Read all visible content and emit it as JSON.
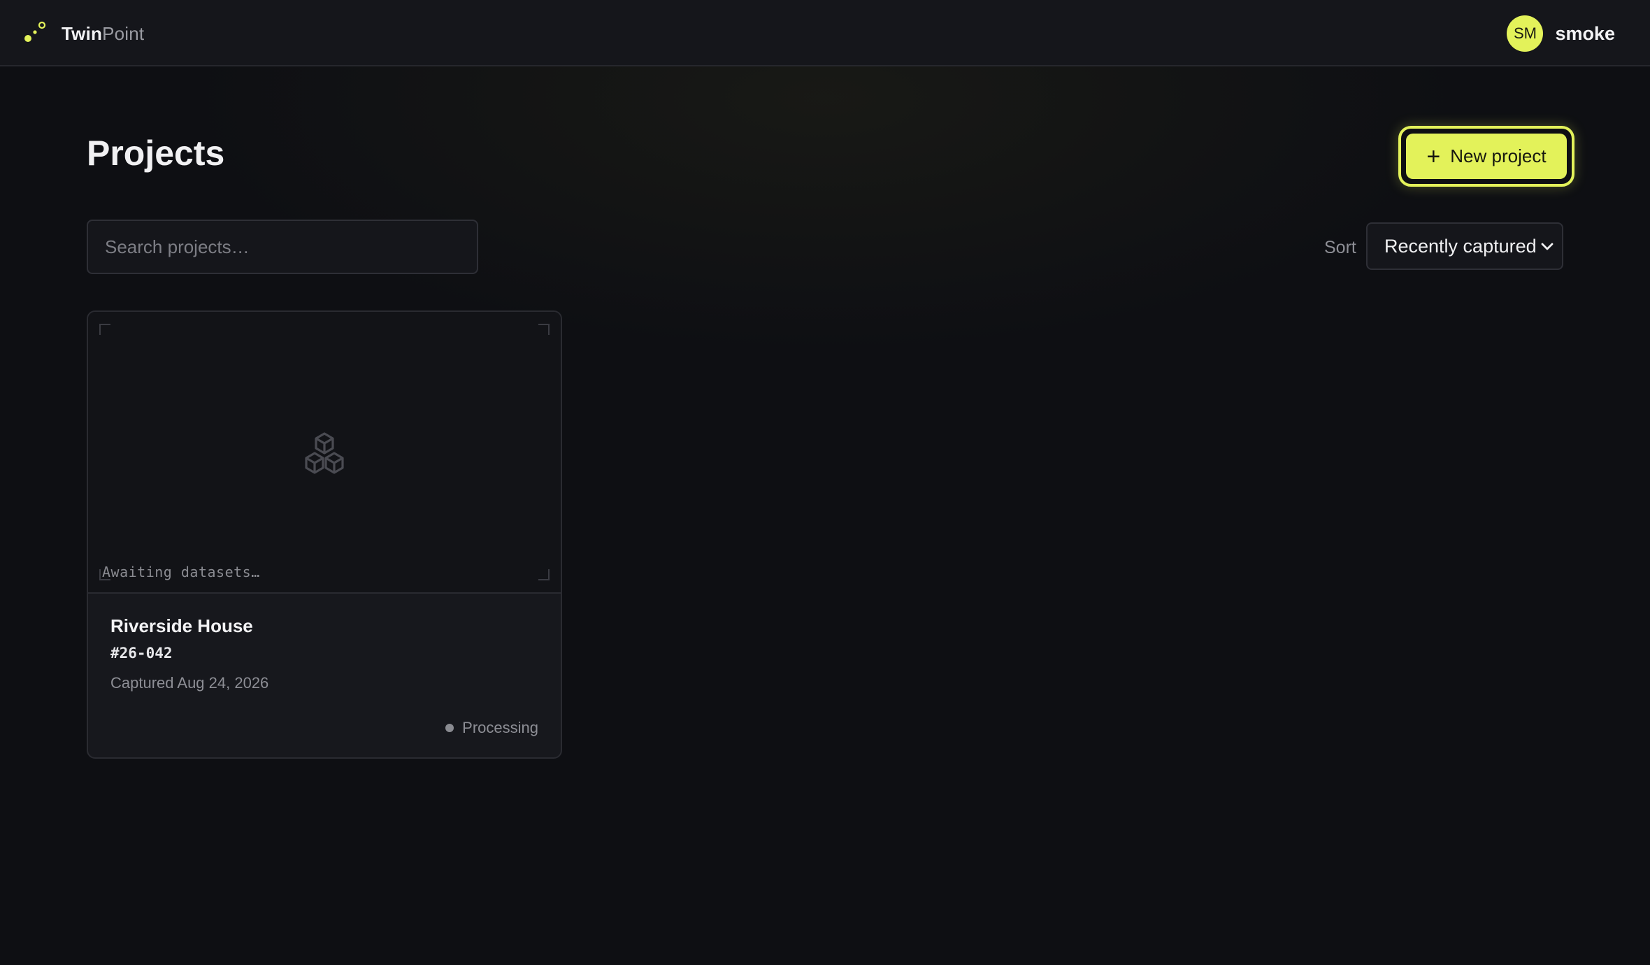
{
  "brand": {
    "name_bold": "Twin",
    "name_light": "Point"
  },
  "user": {
    "initials": "SM",
    "name": "smoke"
  },
  "page": {
    "title": "Projects"
  },
  "actions": {
    "new_project_label": "New project"
  },
  "search": {
    "placeholder": "Search projects…",
    "value": ""
  },
  "sort": {
    "label": "Sort",
    "selected": "Recently captured"
  },
  "projects": [
    {
      "name": "Riverside House",
      "code": "#26-042",
      "captured": "Captured Aug 24, 2026",
      "thumbnail_text": "Awaiting datasets…",
      "status": "Processing"
    }
  ],
  "colors": {
    "accent": "#e3f25a",
    "background": "#0e0f13",
    "surface": "#15161b",
    "muted_text": "#8d8e95"
  }
}
